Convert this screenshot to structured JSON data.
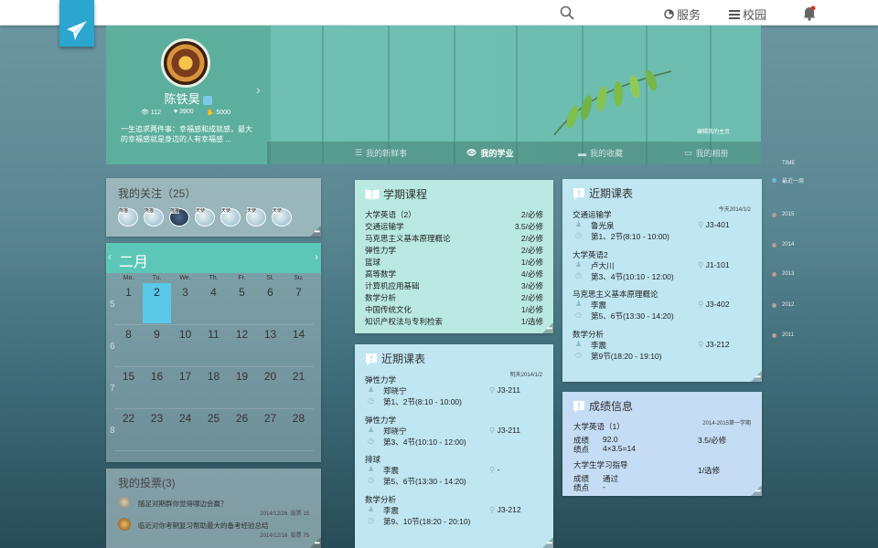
{
  "topbar": {
    "service": "服务",
    "campus": "校园"
  },
  "profile": {
    "name": "陈铁昊",
    "views": "112",
    "likes": "3900",
    "thumbs": "5000",
    "bio": "一生追求两件事：幸福感和成就感，最大的幸福感就是身边的人有幸福感 ..."
  },
  "tabs": [
    {
      "label": "我的新鲜事"
    },
    {
      "label": "我的学业"
    },
    {
      "label": "我的收藏"
    },
    {
      "label": "我的相册"
    }
  ],
  "album_label": "编辑我的主页",
  "timeline": [
    "TIME",
    "最近一周",
    "2015",
    "2014",
    "2013",
    "2012",
    "2011"
  ],
  "follow": {
    "title": "我的关注（25）",
    "items": [
      "熊猫",
      "熊猫",
      "熊猫",
      "天使",
      "天使",
      "天使",
      "天使"
    ]
  },
  "calendar": {
    "month": "二月",
    "weekdays": [
      "Mo.",
      "Tu.",
      "We.",
      "Th.",
      "Fr.",
      "St.",
      "Su."
    ],
    "weeks": [
      {
        "n": "5",
        "days": [
          "1",
          "2",
          "3",
          "4",
          "5",
          "6",
          "7"
        ]
      },
      {
        "n": "6",
        "days": [
          "8",
          "9",
          "10",
          "11",
          "12",
          "13",
          "14"
        ]
      },
      {
        "n": "7",
        "days": [
          "15",
          "16",
          "17",
          "18",
          "19",
          "20",
          "21"
        ]
      },
      {
        "n": "8",
        "days": [
          "22",
          "23",
          "24",
          "25",
          "26",
          "27",
          "28"
        ]
      }
    ]
  },
  "vote": {
    "title": "我的投票(3)",
    "items": [
      {
        "text": "随足对期群你觉得哪边会赢？",
        "date": "2014/12/26",
        "count": "投票 15"
      },
      {
        "text": "临近对你考期复习帮助最大的备考经验总结",
        "date": "2014/12/16",
        "count": "投票 75"
      }
    ]
  },
  "term": {
    "title": "学期课程",
    "courses": [
      {
        "name": "大学英语（2）",
        "credit": "2/必修"
      },
      {
        "name": "交通运输学",
        "credit": "3.5/必修"
      },
      {
        "name": "马克思主义基本原理概论",
        "credit": "2/必修"
      },
      {
        "name": "弹性力学",
        "credit": "2/必修"
      },
      {
        "name": "篮球",
        "credit": "1/必修"
      },
      {
        "name": "高等数学",
        "credit": "4/必修"
      },
      {
        "name": "计算机应用基础",
        "credit": "3/必修"
      },
      {
        "name": "数学分析",
        "credit": "2/必修"
      },
      {
        "name": "中国传统文化",
        "credit": "1/必修"
      },
      {
        "name": "知识产权法与专利检索",
        "credit": "1/选修"
      }
    ]
  },
  "sched_mid": {
    "title": "近期课表",
    "date": "明天2014/1/2",
    "items": [
      {
        "name": "弹性力学",
        "person": "郑晓宁",
        "time": "第1、2节(8:10 - 10:00)",
        "loc": "J3-211"
      },
      {
        "name": "弹性力学",
        "person": "郑晓宁",
        "time": "第3、4节(10:10 - 12:00)",
        "loc": "J3-211"
      },
      {
        "name": "排球",
        "person": "李震",
        "time": "第5、6节(13:30 - 14:20)",
        "loc": "-"
      },
      {
        "name": "数学分析",
        "person": "李震",
        "time": "第9、10节(18:20 - 20:10)",
        "loc": "J3-212"
      }
    ]
  },
  "sched_right": {
    "title": "近期课表",
    "date": "今天2014/1/2",
    "items": [
      {
        "name": "交通运输学",
        "person": "鲁光泉",
        "time": "第1、2节(8:10 - 10:00)",
        "loc": "J3-401"
      },
      {
        "name": "大学英语2",
        "person": "卢大川",
        "time": "第3、4节(10:10 - 12:00)",
        "loc": "J1-101"
      },
      {
        "name": "马克思主义基本原理概论",
        "person": "李震",
        "time": "第5、6节(13:30 - 14:20)",
        "loc": "J3-402"
      },
      {
        "name": "数学分析",
        "person": "李震",
        "time": "第9节(18:20 - 19:10)",
        "loc": "J3-212"
      }
    ]
  },
  "grade": {
    "title": "成绩信息",
    "term": "2014-2015第一学期",
    "items": [
      {
        "name": "大学英语（1）",
        "score_label": "成绩",
        "score": "92.0",
        "credit_label": "绩点",
        "credit": "4×3.5=14",
        "type": "3.5/必修"
      },
      {
        "name": "大学生学习指导",
        "score_label": "成绩",
        "score": "通过",
        "credit_label": "绩点",
        "credit": "-",
        "type": "1/选修"
      }
    ]
  },
  "colors": {
    "accent": "#5cc7b6",
    "topbar": "#ffffff",
    "logo": "#2aa6cf"
  }
}
